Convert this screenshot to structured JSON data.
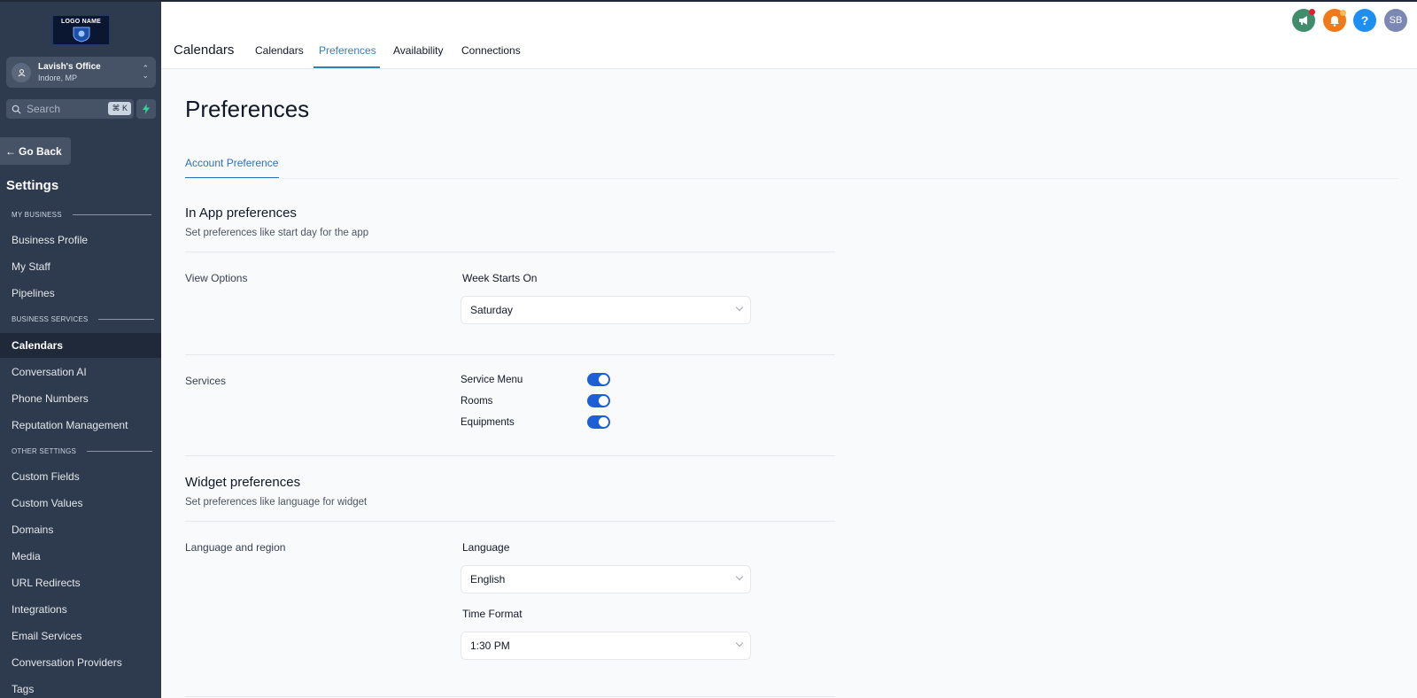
{
  "sidebar": {
    "logo_text": "LOGO NAME",
    "location": {
      "name": "Lavish's Office",
      "subtitle": "Indore, MP"
    },
    "search": {
      "placeholder": "Search",
      "shortcut": "⌘ K"
    },
    "go_back": "Go Back",
    "title": "Settings",
    "sections": {
      "my_business": "MY BUSINESS",
      "business_services": "BUSINESS SERVICES",
      "other_settings": "OTHER SETTINGS"
    },
    "items": [
      {
        "label": "Business Profile"
      },
      {
        "label": "My Staff"
      },
      {
        "label": "Pipelines"
      },
      {
        "label": "Calendars",
        "active": true
      },
      {
        "label": "Conversation AI"
      },
      {
        "label": "Phone Numbers"
      },
      {
        "label": "Reputation Management"
      },
      {
        "label": "Custom Fields"
      },
      {
        "label": "Custom Values"
      },
      {
        "label": "Domains"
      },
      {
        "label": "Media"
      },
      {
        "label": "URL Redirects"
      },
      {
        "label": "Integrations"
      },
      {
        "label": "Email Services"
      },
      {
        "label": "Conversation Providers"
      },
      {
        "label": "Tags"
      }
    ]
  },
  "header": {
    "title": "Calendars",
    "tabs": [
      {
        "label": "Calendars"
      },
      {
        "label": "Preferences",
        "active": true
      },
      {
        "label": "Availability"
      },
      {
        "label": "Connections"
      }
    ],
    "icons": [
      "megaphone-icon",
      "bell-icon",
      "help-icon"
    ],
    "avatar_initials": "SB"
  },
  "main": {
    "page_title": "Preferences",
    "subtab": "Account Preference",
    "in_app": {
      "title": "In App preferences",
      "description": "Set preferences like start day for the app",
      "view_options_label": "View Options",
      "week_starts_label": "Week Starts On",
      "week_starts_value": "Saturday"
    },
    "services": {
      "label": "Services",
      "toggles": [
        {
          "label": "Service Menu",
          "on": true
        },
        {
          "label": "Rooms",
          "on": true
        },
        {
          "label": "Equipments",
          "on": true
        }
      ]
    },
    "widget": {
      "title": "Widget preferences",
      "description": "Set preferences like language for widget",
      "lang_region_label": "Language and region",
      "language_label": "Language",
      "language_value": "English",
      "time_format_label": "Time Format",
      "time_format_value": "1:30 PM"
    }
  },
  "colors": {
    "sidebar_bg": "#2e3a4e",
    "accent": "#2f80b5",
    "toggle_on": "#1d5fd6"
  }
}
